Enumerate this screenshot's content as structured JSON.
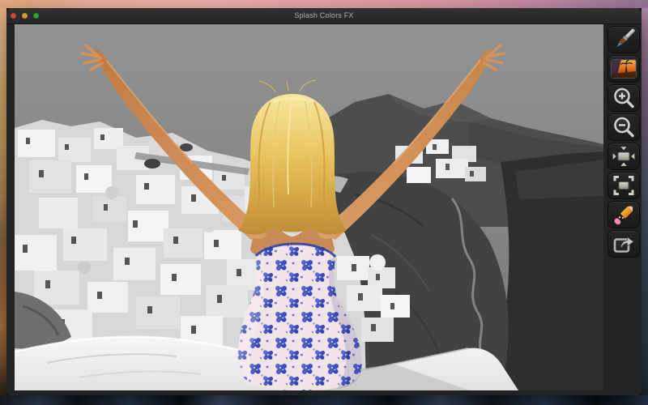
{
  "window": {
    "title": "Splash Colors FX",
    "controls": [
      {
        "name": "close",
        "color": "#d5423c"
      },
      {
        "name": "minimize",
        "color": "#d99a32"
      },
      {
        "name": "zoom",
        "color": "#2fa135"
      }
    ]
  },
  "toolbar": {
    "tools": [
      {
        "icon": "paintbrush-icon"
      },
      {
        "icon": "sample-photo-icon"
      },
      {
        "icon": "zoom-in-icon"
      },
      {
        "icon": "zoom-out-icon"
      },
      {
        "icon": "actual-size-icon"
      },
      {
        "icon": "fit-to-window-icon"
      },
      {
        "icon": "pencil-eraser-icon"
      },
      {
        "icon": "export-share-icon"
      }
    ]
  },
  "canvas": {
    "description": "Color-splash photo: grayscale Santorini hillside village and caldera cliffs; woman seated with arms raised keeps color - blonde hair, tan skin, blue floral strapless dress",
    "colors": {
      "hair_blonde": "#e8c25e",
      "skin_tan": "#c8895a",
      "dress_blue": "#4455c0",
      "dress_base": "#f2e3e8",
      "grayscale_sky": "#858585",
      "sea_dark": "#2e2e2e"
    }
  },
  "desktop": {
    "wallpaper_top_pink": "#eeb3a2",
    "wallpaper_right_purple": "#6f6180",
    "wallpaper_bottom_navy": "#2c3a52",
    "wallpaper_left_gold": "#d8ae6b"
  }
}
